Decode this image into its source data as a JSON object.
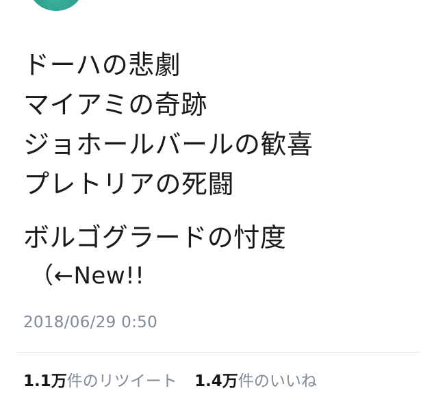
{
  "tweet": {
    "lines": [
      "ドーハの悲劇",
      "マイアミの奇跡",
      "ジョホールバールの歓喜",
      "プレトリアの死闘",
      "ボルゴグラードの忖度",
      "（←New!!"
    ],
    "timestamp": "2018/06/29 0:50"
  },
  "stats": {
    "retweets": {
      "count": "1.1万",
      "label": "件のリツイート"
    },
    "likes": {
      "count": "1.4万",
      "label": "件のいいね"
    }
  },
  "colors": {
    "text": "#1a1a1a",
    "muted": "#7f8a96",
    "divider": "#e1e6ea"
  }
}
